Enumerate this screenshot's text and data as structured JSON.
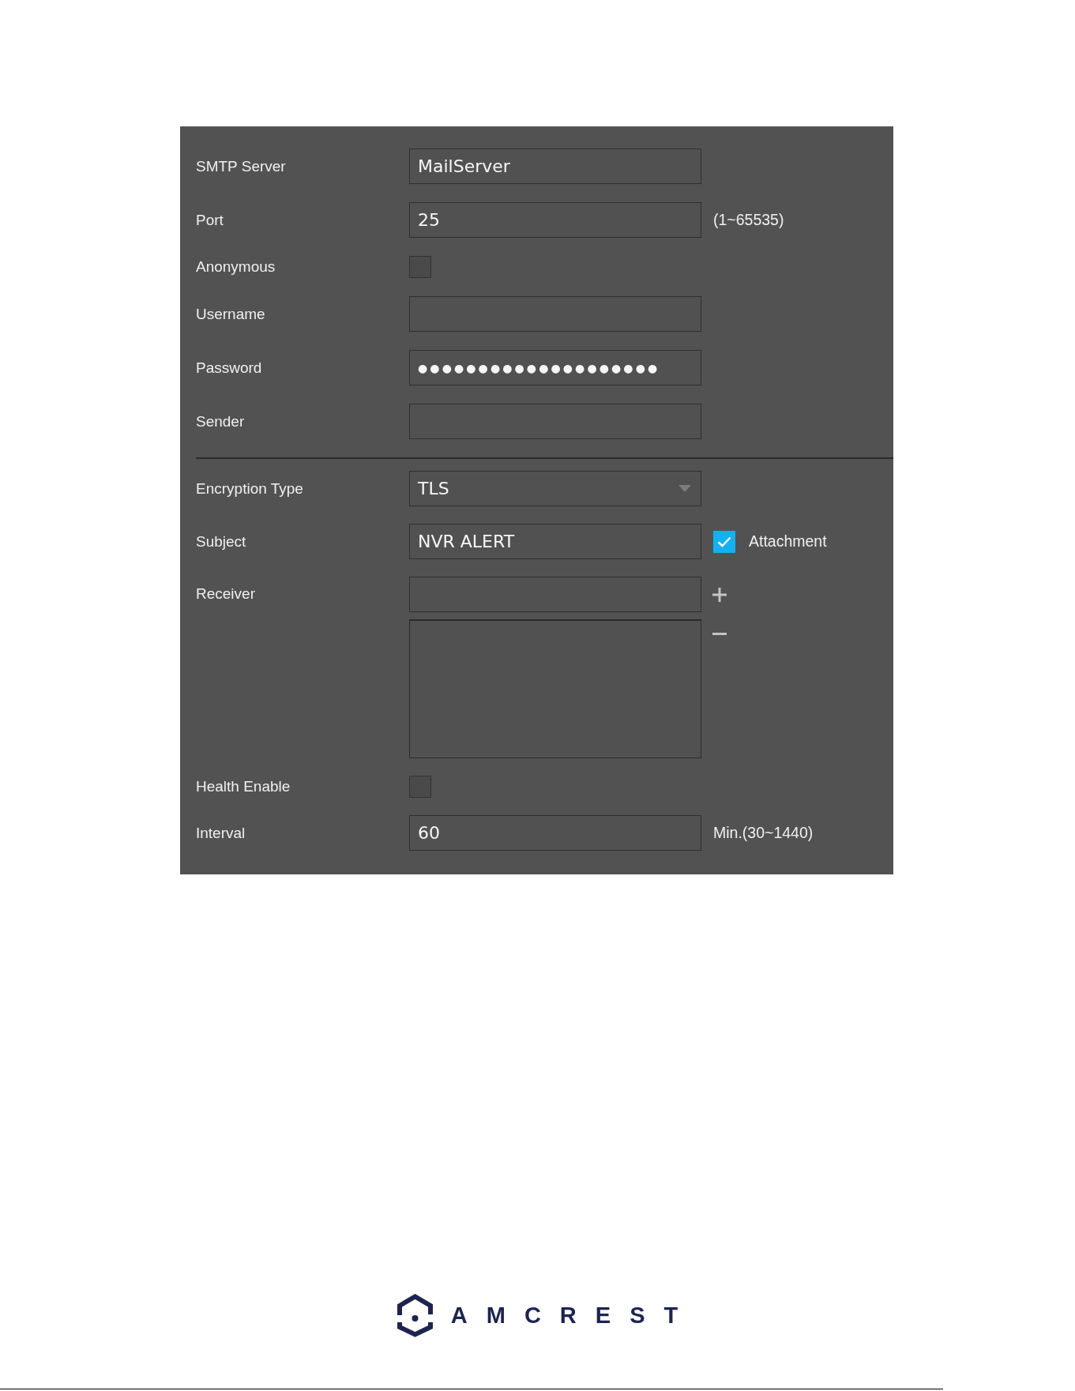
{
  "form": {
    "sections": [
      {
        "rows": [
          {
            "kind": "text",
            "label": "SMTP Server",
            "value": "MailServer"
          },
          {
            "kind": "text",
            "label": "Port",
            "value": "25",
            "hint": "(1~65535)"
          },
          {
            "kind": "checkbox",
            "label": "Anonymous",
            "checked": false
          },
          {
            "kind": "text",
            "label": "Username"
          },
          {
            "kind": "password",
            "label": "Password",
            "value": "●●●●●●●●●●●●●●●●●●●●"
          },
          {
            "kind": "text",
            "label": "Sender"
          }
        ]
      },
      {
        "rows": [
          {
            "kind": "select",
            "label": "Encryption Type",
            "value": "TLS"
          },
          {
            "kind": "text",
            "label": "Subject",
            "value": "NVR ALERT",
            "option": {
              "label": "Attachment",
              "checked": true
            }
          },
          {
            "kind": "list",
            "label": "Receiver"
          },
          {
            "kind": "checkbox",
            "label": "Health Enable",
            "checked": false
          },
          {
            "kind": "text",
            "label": "Interval",
            "value": "60",
            "hint": "Min.(30~1440)"
          }
        ]
      }
    ]
  },
  "logo": {
    "text": "AMCREST"
  }
}
